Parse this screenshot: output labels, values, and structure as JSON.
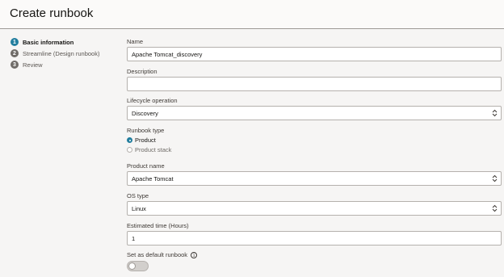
{
  "header": {
    "title": "Create runbook"
  },
  "steps": [
    {
      "num": "1",
      "label": "Basic information",
      "active": true
    },
    {
      "num": "2",
      "label": "Streamline (Design runbook)",
      "active": false
    },
    {
      "num": "3",
      "label": "Review",
      "active": false
    }
  ],
  "form": {
    "name": {
      "label": "Name",
      "value": "Apache Tomcat_discovery"
    },
    "description": {
      "label": "Description",
      "value": ""
    },
    "lifecycle": {
      "label": "Lifecycle operation",
      "value": "Discovery"
    },
    "runbook_type": {
      "label": "Runbook type",
      "options": [
        {
          "label": "Product",
          "checked": true
        },
        {
          "label": "Product stack",
          "checked": false
        }
      ]
    },
    "product_name": {
      "label": "Product name",
      "value": "Apache Tomcat"
    },
    "os_type": {
      "label": "OS type",
      "value": "Linux"
    },
    "estimated_time": {
      "label": "Estimated time (Hours)",
      "value": "1"
    },
    "default_runbook": {
      "label": "Set as default runbook",
      "enabled": false
    }
  },
  "colors": {
    "accent": "#227e9e",
    "header_border": "#9e9a96",
    "background": "#f6f5f4"
  }
}
